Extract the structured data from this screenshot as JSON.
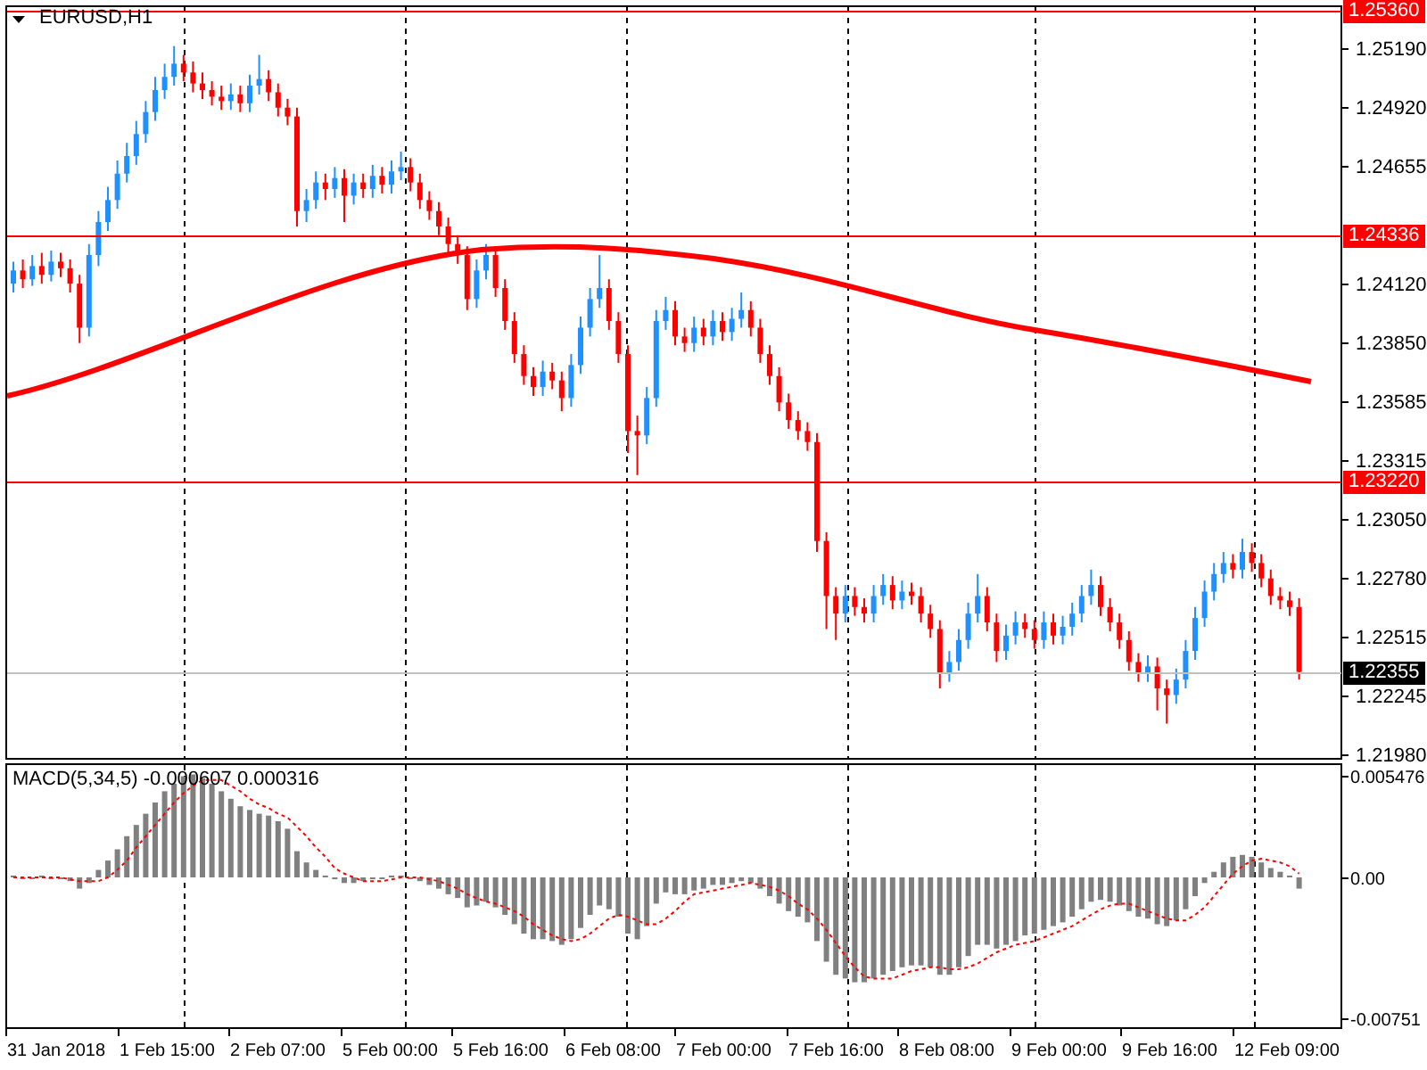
{
  "symbol_menu": {
    "label": "EURUSD,H1"
  },
  "price_chart": {
    "chart_data": {
      "type": "candlestick",
      "ylim": [
        1.21964,
        1.25377
      ],
      "yticks": [
        {
          "value": 1.2519,
          "label": "1.25190"
        },
        {
          "value": 1.2492,
          "label": "1.24920"
        },
        {
          "value": 1.24655,
          "label": "1.24655"
        },
        {
          "value": 1.2412,
          "label": "1.24120"
        },
        {
          "value": 1.2385,
          "label": "1.23850"
        },
        {
          "value": 1.23585,
          "label": "1.23585"
        },
        {
          "value": 1.23315,
          "label": "1.23315"
        },
        {
          "value": 1.2305,
          "label": "1.23050"
        },
        {
          "value": 1.2278,
          "label": "1.22780"
        },
        {
          "value": 1.22515,
          "label": "1.22515"
        },
        {
          "value": 1.22245,
          "label": "1.22245"
        },
        {
          "value": 1.2198,
          "label": "1.21980"
        }
      ],
      "ohlc": [
        [
          1.2412,
          1.2422,
          1.2408,
          1.2418
        ],
        [
          1.2418,
          1.2423,
          1.241,
          1.2414
        ],
        [
          1.2414,
          1.2425,
          1.2411,
          1.242
        ],
        [
          1.242,
          1.2426,
          1.2412,
          1.2416
        ],
        [
          1.2416,
          1.2427,
          1.2413,
          1.2422
        ],
        [
          1.2422,
          1.2426,
          1.2415,
          1.2419
        ],
        [
          1.2419,
          1.2423,
          1.2408,
          1.2412
        ],
        [
          1.2412,
          1.2416,
          1.2385,
          1.2392
        ],
        [
          1.2392,
          1.243,
          1.2388,
          1.2425
        ],
        [
          1.2425,
          1.2445,
          1.242,
          1.244
        ],
        [
          1.244,
          1.2456,
          1.2436,
          1.245
        ],
        [
          1.245,
          1.2468,
          1.2446,
          1.2462
        ],
        [
          1.2462,
          1.2476,
          1.2458,
          1.247
        ],
        [
          1.247,
          1.2486,
          1.2466,
          1.248
        ],
        [
          1.248,
          1.2495,
          1.2476,
          1.249
        ],
        [
          1.249,
          1.2506,
          1.2486,
          1.25
        ],
        [
          1.25,
          1.2512,
          1.2496,
          1.2506
        ],
        [
          1.2506,
          1.252,
          1.2502,
          1.2512
        ],
        [
          1.2512,
          1.2516,
          1.2504,
          1.2508
        ],
        [
          1.2508,
          1.2513,
          1.2499,
          1.2503
        ],
        [
          1.2503,
          1.2508,
          1.2496,
          1.25
        ],
        [
          1.25,
          1.2504,
          1.2493,
          1.2497
        ],
        [
          1.2497,
          1.2502,
          1.2491,
          1.2495
        ],
        [
          1.2495,
          1.2503,
          1.2491,
          1.2498
        ],
        [
          1.2498,
          1.2502,
          1.249,
          1.2494
        ],
        [
          1.2494,
          1.2507,
          1.249,
          1.2502
        ],
        [
          1.2502,
          1.2516,
          1.2498,
          1.2505
        ],
        [
          1.2505,
          1.2509,
          1.2495,
          1.2499
        ],
        [
          1.2499,
          1.2503,
          1.2488,
          1.2492
        ],
        [
          1.2492,
          1.2496,
          1.2484,
          1.2488
        ],
        [
          1.2488,
          1.2492,
          1.2438,
          1.2445
        ],
        [
          1.2445,
          1.2455,
          1.244,
          1.245
        ],
        [
          1.245,
          1.2463,
          1.2446,
          1.2458
        ],
        [
          1.2458,
          1.2462,
          1.245,
          1.2455
        ],
        [
          1.2455,
          1.2465,
          1.2451,
          1.246
        ],
        [
          1.246,
          1.2464,
          1.244,
          1.2452
        ],
        [
          1.2452,
          1.2462,
          1.2448,
          1.2458
        ],
        [
          1.2458,
          1.2462,
          1.2451,
          1.2455
        ],
        [
          1.2455,
          1.2466,
          1.2451,
          1.2461
        ],
        [
          1.2461,
          1.2465,
          1.2453,
          1.2457
        ],
        [
          1.2457,
          1.2468,
          1.2453,
          1.2463
        ],
        [
          1.2463,
          1.2472,
          1.2459,
          1.2465
        ],
        [
          1.2465,
          1.2469,
          1.2454,
          1.2458
        ],
        [
          1.2458,
          1.2462,
          1.2446,
          1.245
        ],
        [
          1.245,
          1.2454,
          1.2441,
          1.2445
        ],
        [
          1.2445,
          1.2449,
          1.2434,
          1.2438
        ],
        [
          1.2438,
          1.2442,
          1.2426,
          1.243
        ],
        [
          1.243,
          1.2434,
          1.2421,
          1.2425
        ],
        [
          1.2425,
          1.2429,
          1.24,
          1.2405
        ],
        [
          1.2405,
          1.2423,
          1.2401,
          1.2418
        ],
        [
          1.2418,
          1.243,
          1.2414,
          1.2425
        ],
        [
          1.2425,
          1.2429,
          1.2406,
          1.241
        ],
        [
          1.241,
          1.2414,
          1.2391,
          1.2395
        ],
        [
          1.2395,
          1.2399,
          1.2376,
          1.238
        ],
        [
          1.238,
          1.2384,
          1.2366,
          1.237
        ],
        [
          1.237,
          1.2374,
          1.2361,
          1.2365
        ],
        [
          1.2365,
          1.2377,
          1.2361,
          1.2372
        ],
        [
          1.2372,
          1.2376,
          1.2364,
          1.2368
        ],
        [
          1.2368,
          1.2372,
          1.2354,
          1.236
        ],
        [
          1.236,
          1.238,
          1.2356,
          1.2375
        ],
        [
          1.2375,
          1.2397,
          1.2371,
          1.2392
        ],
        [
          1.2392,
          1.241,
          1.2388,
          1.2405
        ],
        [
          1.2405,
          1.2425,
          1.2401,
          1.241
        ],
        [
          1.241,
          1.2414,
          1.2391,
          1.2395
        ],
        [
          1.2395,
          1.2399,
          1.2376,
          1.238
        ],
        [
          1.238,
          1.2384,
          1.2335,
          1.2345
        ],
        [
          1.2345,
          1.2352,
          1.2325,
          1.2343
        ],
        [
          1.2343,
          1.2365,
          1.2339,
          1.236
        ],
        [
          1.236,
          1.24,
          1.2356,
          1.2395
        ],
        [
          1.2395,
          1.2406,
          1.2391,
          1.24
        ],
        [
          1.24,
          1.2404,
          1.2384,
          1.2388
        ],
        [
          1.2388,
          1.2392,
          1.2381,
          1.2385
        ],
        [
          1.2385,
          1.2397,
          1.2381,
          1.2392
        ],
        [
          1.2392,
          1.2396,
          1.2384,
          1.2388
        ],
        [
          1.2388,
          1.24,
          1.2384,
          1.2395
        ],
        [
          1.2395,
          1.2399,
          1.2386,
          1.239
        ],
        [
          1.239,
          1.2401,
          1.2386,
          1.2396
        ],
        [
          1.2396,
          1.2408,
          1.2392,
          1.24
        ],
        [
          1.24,
          1.2404,
          1.2388,
          1.2392
        ],
        [
          1.2392,
          1.2396,
          1.2376,
          1.238
        ],
        [
          1.238,
          1.2384,
          1.2366,
          1.237
        ],
        [
          1.237,
          1.2374,
          1.2354,
          1.2358
        ],
        [
          1.2358,
          1.2362,
          1.2346,
          1.235
        ],
        [
          1.235,
          1.2354,
          1.2341,
          1.2345
        ],
        [
          1.2345,
          1.2349,
          1.2336,
          1.234
        ],
        [
          1.234,
          1.2344,
          1.229,
          1.2295
        ],
        [
          1.2295,
          1.2299,
          1.2255,
          1.227
        ],
        [
          1.227,
          1.2274,
          1.225,
          1.2262
        ],
        [
          1.2262,
          1.2275,
          1.2258,
          1.227
        ],
        [
          1.227,
          1.2274,
          1.2261,
          1.2265
        ],
        [
          1.2265,
          1.2269,
          1.2258,
          1.2262
        ],
        [
          1.2262,
          1.2275,
          1.2258,
          1.227
        ],
        [
          1.227,
          1.228,
          1.2266,
          1.2275
        ],
        [
          1.2275,
          1.2279,
          1.2264,
          1.2268
        ],
        [
          1.2268,
          1.2277,
          1.2264,
          1.2272
        ],
        [
          1.2272,
          1.2276,
          1.2266,
          1.227
        ],
        [
          1.227,
          1.2274,
          1.2258,
          1.2262
        ],
        [
          1.2262,
          1.2266,
          1.2251,
          1.2255
        ],
        [
          1.2255,
          1.2259,
          1.2228,
          1.2235
        ],
        [
          1.2235,
          1.2245,
          1.2231,
          1.224
        ],
        [
          1.224,
          1.2255,
          1.2236,
          1.225
        ],
        [
          1.225,
          1.2267,
          1.2246,
          1.2262
        ],
        [
          1.2262,
          1.228,
          1.2258,
          1.227
        ],
        [
          1.227,
          1.2274,
          1.2254,
          1.2258
        ],
        [
          1.2258,
          1.2262,
          1.224,
          1.2245
        ],
        [
          1.2245,
          1.2257,
          1.2241,
          1.2252
        ],
        [
          1.2252,
          1.2263,
          1.2248,
          1.2258
        ],
        [
          1.2258,
          1.2262,
          1.2251,
          1.2255
        ],
        [
          1.2255,
          1.2259,
          1.2246,
          1.225
        ],
        [
          1.225,
          1.2263,
          1.2246,
          1.2258
        ],
        [
          1.2258,
          1.2262,
          1.2248,
          1.2252
        ],
        [
          1.2252,
          1.2261,
          1.2248,
          1.2256
        ],
        [
          1.2256,
          1.2267,
          1.2252,
          1.2262
        ],
        [
          1.2262,
          1.2275,
          1.2258,
          1.227
        ],
        [
          1.227,
          1.2282,
          1.2266,
          1.2275
        ],
        [
          1.2275,
          1.2279,
          1.2261,
          1.2265
        ],
        [
          1.2265,
          1.2269,
          1.2254,
          1.2258
        ],
        [
          1.2258,
          1.2262,
          1.2246,
          1.225
        ],
        [
          1.225,
          1.2254,
          1.2236,
          1.224
        ],
        [
          1.224,
          1.2244,
          1.2231,
          1.2235
        ],
        [
          1.2235,
          1.2243,
          1.2231,
          1.2238
        ],
        [
          1.2238,
          1.2242,
          1.2218,
          1.2228
        ],
        [
          1.2228,
          1.2232,
          1.2212,
          1.2225
        ],
        [
          1.2225,
          1.2237,
          1.2221,
          1.2232
        ],
        [
          1.2232,
          1.225,
          1.2228,
          1.2245
        ],
        [
          1.2245,
          1.2265,
          1.2241,
          1.226
        ],
        [
          1.226,
          1.2277,
          1.2256,
          1.2272
        ],
        [
          1.2272,
          1.2285,
          1.2268,
          1.228
        ],
        [
          1.228,
          1.229,
          1.2276,
          1.2285
        ],
        [
          1.2285,
          1.2289,
          1.2278,
          1.2282
        ],
        [
          1.2282,
          1.2296,
          1.2278,
          1.229
        ],
        [
          1.229,
          1.2294,
          1.2281,
          1.2285
        ],
        [
          1.2285,
          1.2289,
          1.2274,
          1.2278
        ],
        [
          1.2278,
          1.2282,
          1.2266,
          1.227
        ],
        [
          1.227,
          1.2274,
          1.2264,
          1.2268
        ],
        [
          1.2268,
          1.2272,
          1.2261,
          1.2265
        ],
        [
          1.2265,
          1.2269,
          1.2232,
          1.22355
        ]
      ]
    }
  },
  "level_lines": [
    {
      "price": "1.25360",
      "kind": "level"
    },
    {
      "price": "1.24336",
      "kind": "level"
    },
    {
      "price": "1.23220",
      "kind": "level"
    },
    {
      "price": "1.22355",
      "kind": "bid"
    }
  ],
  "time_axis": {
    "ticks": [
      "31 Jan 2018",
      "1 Feb 15:00",
      "2 Feb 07:00",
      "5 Feb 00:00",
      "5 Feb 16:00",
      "6 Feb 08:00",
      "7 Feb 00:00",
      "7 Feb 16:00",
      "8 Feb 08:00",
      "9 Feb 00:00",
      "9 Feb 16:00",
      "12 Feb 09:00"
    ]
  },
  "indicator": {
    "label": "MACD(5,34,5) -0.000607 0.000316",
    "chart_data": {
      "type": "bar",
      "ylim": [
        -0.008,
        0.006
      ],
      "yticks": [
        {
          "value": 0.005476,
          "label": "0.005476"
        },
        {
          "value": 0,
          "label": "0.00"
        },
        {
          "value": -0.00751,
          "label": "-0.00751"
        }
      ],
      "series": [
        {
          "type": "bar",
          "color": "#808080",
          "values": [
            0.0001,
            0,
            0,
            0.0001,
            0,
            -0.0001,
            -0.0002,
            -0.0006,
            -0.0003,
            0.0004,
            0.0009,
            0.0015,
            0.0022,
            0.0028,
            0.0034,
            0.004,
            0.0046,
            0.005,
            0.0054,
            0.0055,
            0.0053,
            0.005,
            0.0046,
            0.0042,
            0.0038,
            0.0036,
            0.0034,
            0.0033,
            0.003,
            0.0026,
            0.0014,
            0.0008,
            0.0004,
            0.0001,
            -0.0001,
            -0.0003,
            -0.0003,
            -0.0002,
            -0.0001,
            0,
            0.0001,
            0.0001,
            0,
            -0.0002,
            -0.0004,
            -0.0006,
            -0.0009,
            -0.0011,
            -0.0016,
            -0.0015,
            -0.0013,
            -0.0016,
            -0.002,
            -0.0025,
            -0.003,
            -0.0033,
            -0.0033,
            -0.0034,
            -0.0036,
            -0.0033,
            -0.0027,
            -0.002,
            -0.0015,
            -0.0017,
            -0.0021,
            -0.003,
            -0.0033,
            -0.0026,
            -0.0014,
            -0.0008,
            -0.0009,
            -0.0009,
            -0.0007,
            -0.0006,
            -0.0004,
            -0.0004,
            -0.0003,
            -0.0002,
            -0.0003,
            -0.0006,
            -0.001,
            -0.0014,
            -0.0018,
            -0.0021,
            -0.0024,
            -0.0034,
            -0.0045,
            -0.0052,
            -0.0054,
            -0.0056,
            -0.0056,
            -0.0054,
            -0.0052,
            -0.005,
            -0.0048,
            -0.0047,
            -0.0047,
            -0.0048,
            -0.0052,
            -0.0052,
            -0.0048,
            -0.0042,
            -0.0036,
            -0.0036,
            -0.0038,
            -0.0036,
            -0.0034,
            -0.0031,
            -0.003,
            -0.0028,
            -0.0026,
            -0.0024,
            -0.0021,
            -0.0017,
            -0.0013,
            -0.0012,
            -0.0013,
            -0.0015,
            -0.0018,
            -0.0021,
            -0.0022,
            -0.0025,
            -0.0026,
            -0.0023,
            -0.0017,
            -0.001,
            -0.0003,
            0.0003,
            0.0008,
            0.0011,
            0.0012,
            0.0011,
            0.0008,
            0.0005,
            0.0003,
            0.0001,
            -0.0006
          ]
        },
        {
          "type": "line",
          "line_style": "dashed",
          "color": "#ff0000",
          "values": [
            0,
            0,
            0,
            0,
            0,
            0,
            -0.0001,
            -0.0002,
            -0.0002,
            -0.0002,
            0,
            0.0004,
            0.0009,
            0.0016,
            0.0022,
            0.0028,
            0.0034,
            0.004,
            0.0045,
            0.0049,
            0.0052,
            0.0052,
            0.0052,
            0.0049,
            0.0046,
            0.0042,
            0.0039,
            0.0037,
            0.0034,
            0.0032,
            0.0027,
            0.0022,
            0.0016,
            0.0011,
            0.0005,
            0.0002,
            0,
            -0.0002,
            -0.0002,
            -0.0002,
            -0.0001,
            0,
            0,
            0,
            -0.0001,
            -0.0002,
            -0.0004,
            -0.0006,
            -0.0009,
            -0.0011,
            -0.0013,
            -0.0014,
            -0.0016,
            -0.0018,
            -0.0021,
            -0.0025,
            -0.0028,
            -0.0031,
            -0.0033,
            -0.0034,
            -0.0033,
            -0.003,
            -0.0026,
            -0.0022,
            -0.002,
            -0.0021,
            -0.0023,
            -0.0025,
            -0.0025,
            -0.0022,
            -0.0018,
            -0.0013,
            -0.0009,
            -0.0008,
            -0.0007,
            -0.0006,
            -0.0005,
            -0.0004,
            -0.0003,
            -0.0004,
            -0.0005,
            -0.0007,
            -0.001,
            -0.0014,
            -0.0017,
            -0.0022,
            -0.0028,
            -0.0035,
            -0.0042,
            -0.0048,
            -0.0053,
            -0.0054,
            -0.0054,
            -0.0054,
            -0.0052,
            -0.005,
            -0.0049,
            -0.0048,
            -0.0048,
            -0.0049,
            -0.0049,
            -0.0048,
            -0.0046,
            -0.0043,
            -0.004,
            -0.0038,
            -0.0036,
            -0.0035,
            -0.0034,
            -0.0032,
            -0.003,
            -0.0028,
            -0.0026,
            -0.0023,
            -0.002,
            -0.0017,
            -0.0015,
            -0.0014,
            -0.0014,
            -0.0016,
            -0.0018,
            -0.002,
            -0.0022,
            -0.0023,
            -0.0023,
            -0.002,
            -0.0016,
            -0.001,
            -0.0004,
            0.0002,
            0.0006,
            0.0009,
            0.001,
            0.0009,
            0.0008,
            0.0006,
            0.0002
          ]
        }
      ]
    }
  }
}
